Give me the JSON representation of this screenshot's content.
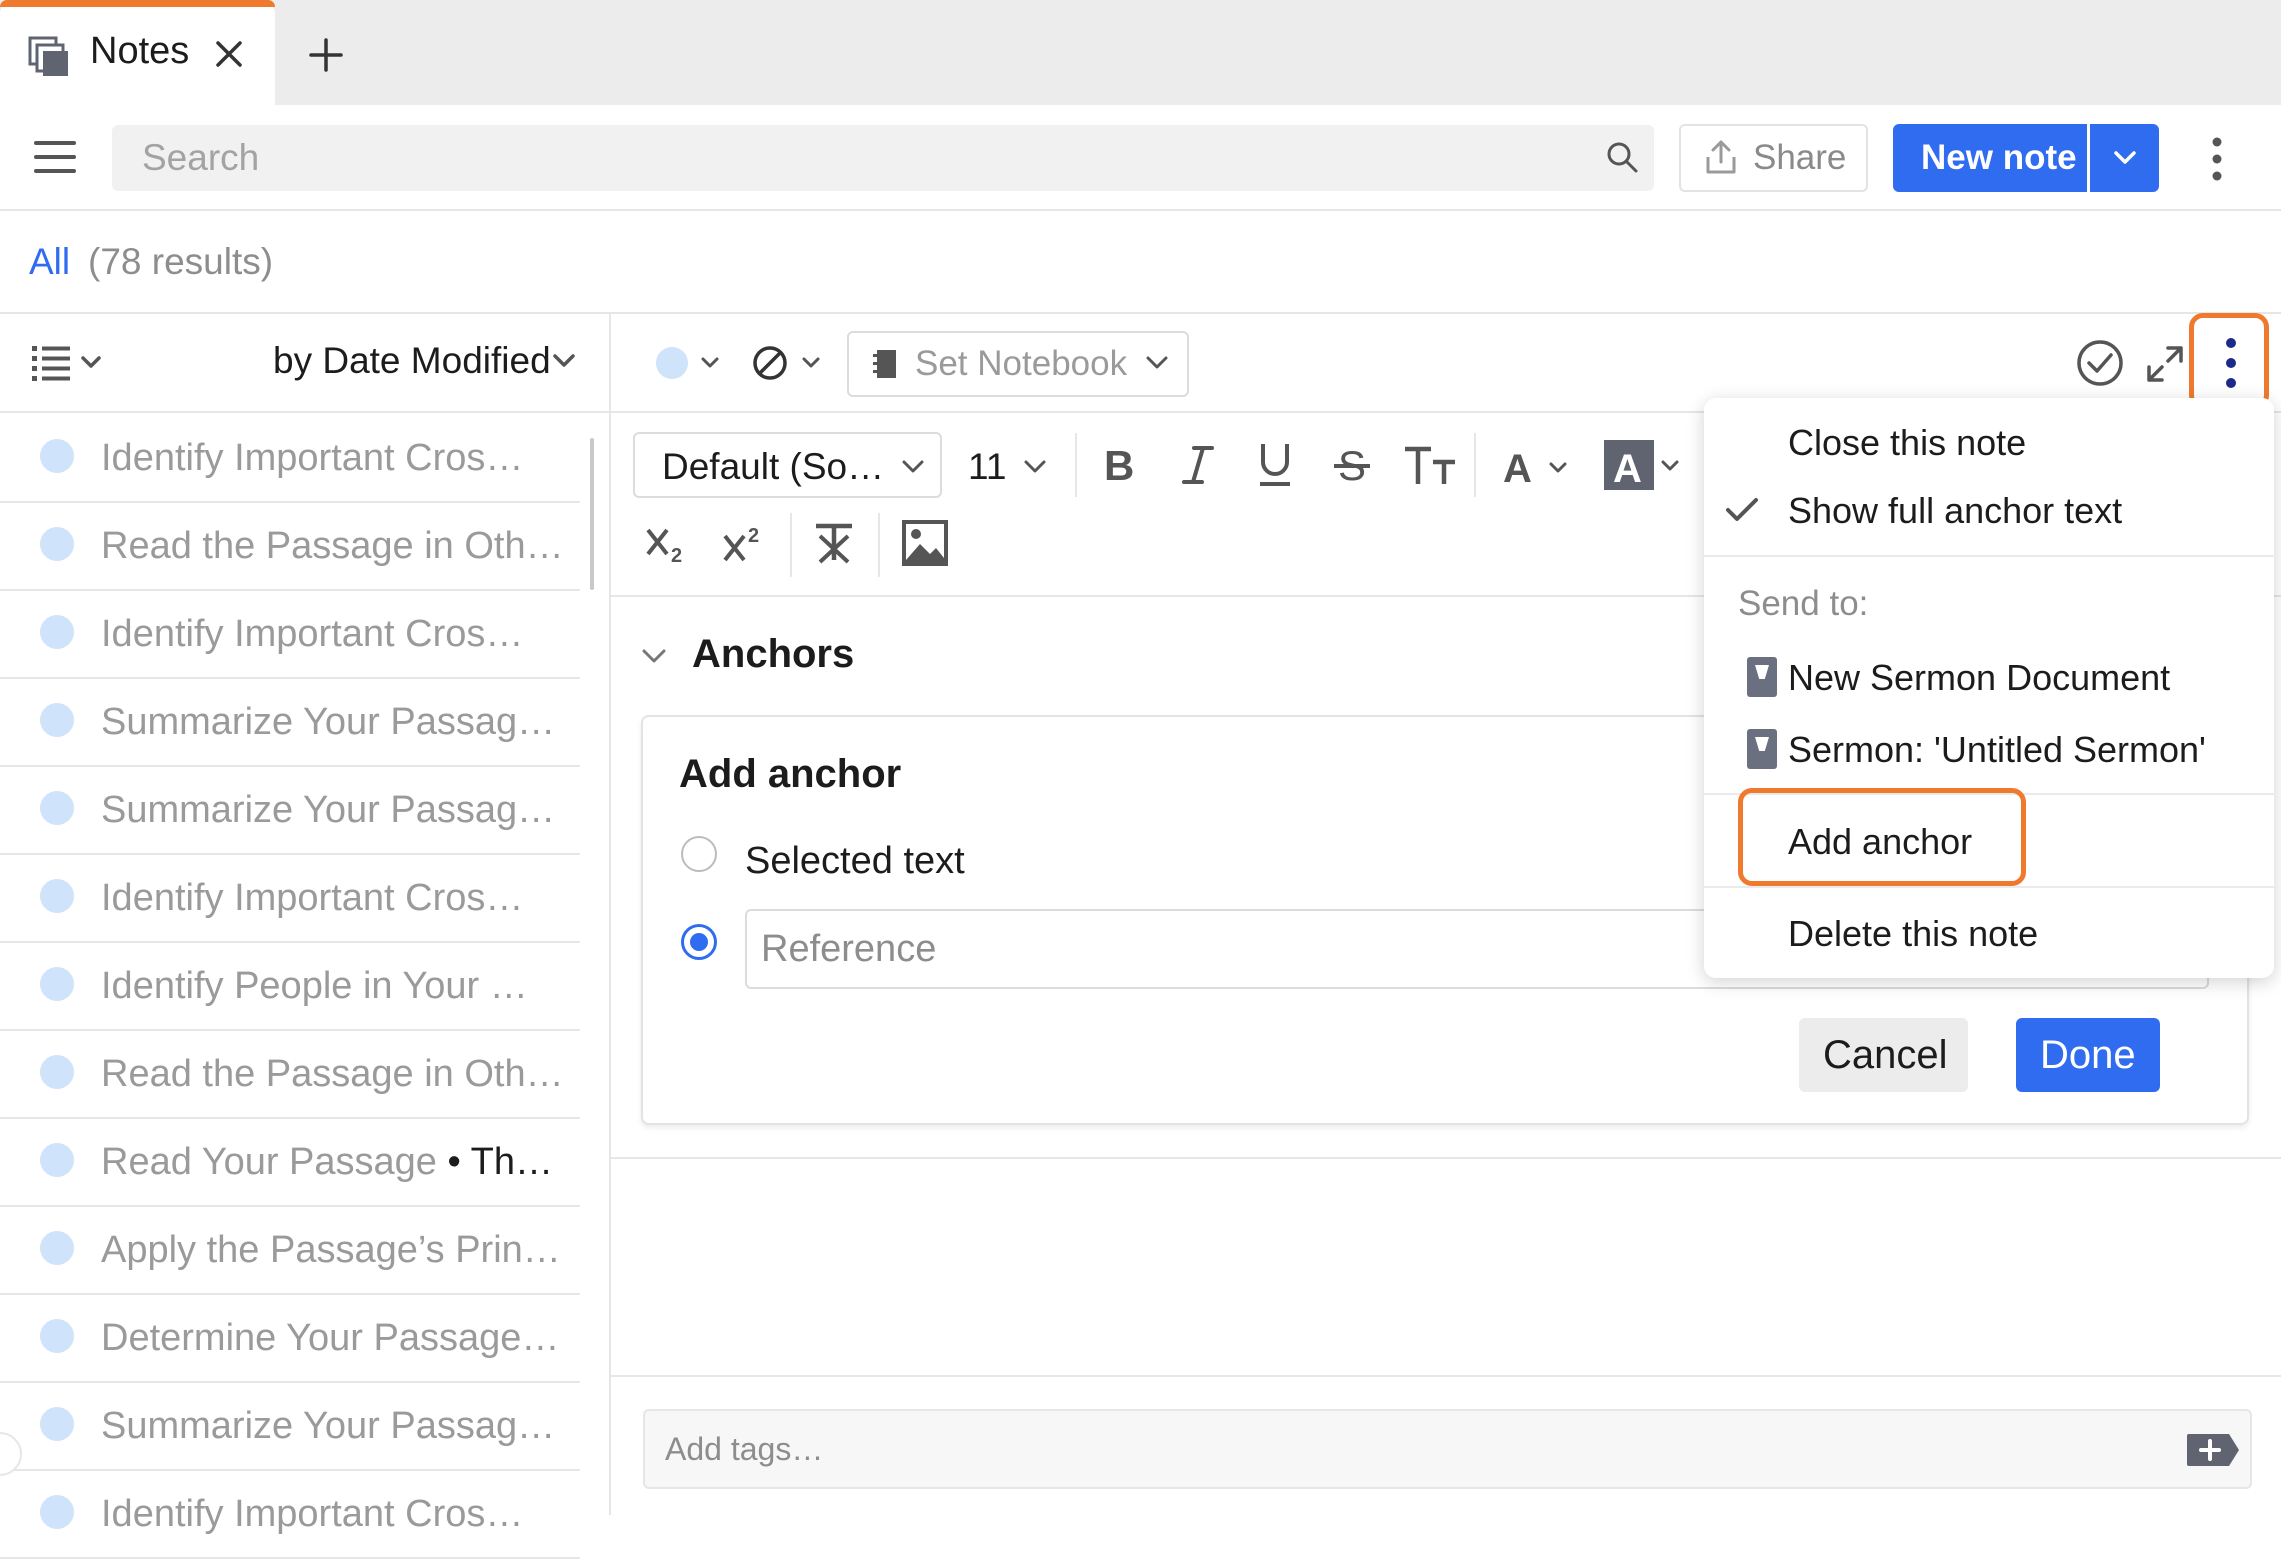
{
  "tabs": [
    {
      "title": "Notes",
      "active": true
    }
  ],
  "accent_color": "#ef7a2e",
  "primary_color": "#2f6cf0",
  "header": {
    "search_placeholder": "Search",
    "share_label": "Share",
    "new_note_label": "New note"
  },
  "filter": {
    "all_label": "All",
    "results": "(78 results)"
  },
  "list": {
    "sort_label": "by Date Modified",
    "notes": [
      {
        "title": "Identify Important Cros…",
        "suffix": ""
      },
      {
        "title": "Read the Passage in Oth…",
        "suffix": ""
      },
      {
        "title": "Identify Important Cros…",
        "suffix": ""
      },
      {
        "title": "Summarize Your Passag…",
        "suffix": ""
      },
      {
        "title": "Summarize Your Passag…",
        "suffix": ""
      },
      {
        "title": "Identify Important Cros…",
        "suffix": ""
      },
      {
        "title": "Identify People in Your …",
        "suffix": ""
      },
      {
        "title": "Read the Passage in Oth…",
        "suffix": ""
      },
      {
        "title": "Read Your Passage",
        "suffix": " • Th…"
      },
      {
        "title": "Apply the Passage’s Prin…",
        "suffix": ""
      },
      {
        "title": "Determine Your Passage…",
        "suffix": ""
      },
      {
        "title": "Summarize Your Passag…",
        "suffix": ""
      },
      {
        "title": "Identify Important Cros…",
        "suffix": ""
      }
    ]
  },
  "editor": {
    "notebook_label": "Set Notebook",
    "font_label": "Default (So…",
    "font_size": "11",
    "anchors_title": "Anchors",
    "add_anchor": {
      "title": "Add anchor",
      "option_selected_text": "Selected text",
      "reference_placeholder": "Reference",
      "selected_option": "reference",
      "cancel_label": "Cancel",
      "done_label": "Done"
    },
    "tags_placeholder": "Add tags…"
  },
  "menu": {
    "close_note": "Close this note",
    "show_full_anchor": "Show full anchor text",
    "show_full_anchor_checked": true,
    "send_to_label": "Send to:",
    "send_targets": [
      "New Sermon Document",
      "Sermon: 'Untitled Sermon'"
    ],
    "add_anchor": "Add anchor",
    "delete_note": "Delete this note"
  }
}
